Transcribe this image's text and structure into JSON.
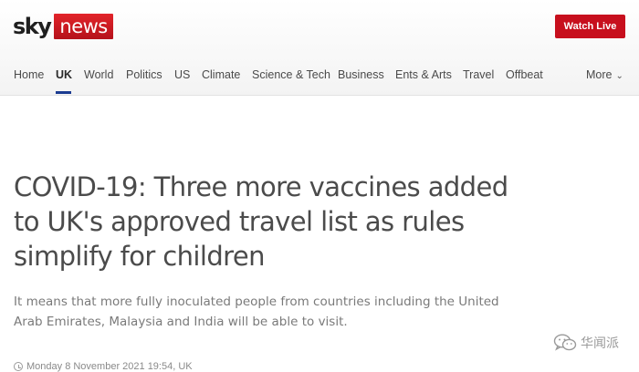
{
  "header": {
    "logo_sky": "sky",
    "logo_news": "news",
    "watch_live_label": "Watch Live",
    "brand_color": "#c70f1d"
  },
  "nav": {
    "items": [
      {
        "label": "Home"
      },
      {
        "label": "UK",
        "active": true
      },
      {
        "label": "World"
      },
      {
        "label": "Politics"
      },
      {
        "label": "US"
      },
      {
        "label": "Climate"
      },
      {
        "label": "Science & Tech"
      },
      {
        "label": "Business"
      },
      {
        "label": "Ents & Arts"
      },
      {
        "label": "Travel"
      },
      {
        "label": "Offbeat"
      }
    ],
    "more_label": "More",
    "more_icon": "chevron-down-icon",
    "active_color": "#1b3b91"
  },
  "article": {
    "headline": "COVID-19: Three more vaccines added to UK's approved travel list as rules simplify for children",
    "standfirst": "It means that more fully inoculated people from countries including the United Arab Emirates, Malaysia and India will be able to visit.",
    "timestamp": "Monday 8 November 2021 19:54, UK",
    "timestamp_icon": "clock-icon"
  },
  "watermark": {
    "text": "华闻派",
    "icon": "wechat-icon"
  }
}
